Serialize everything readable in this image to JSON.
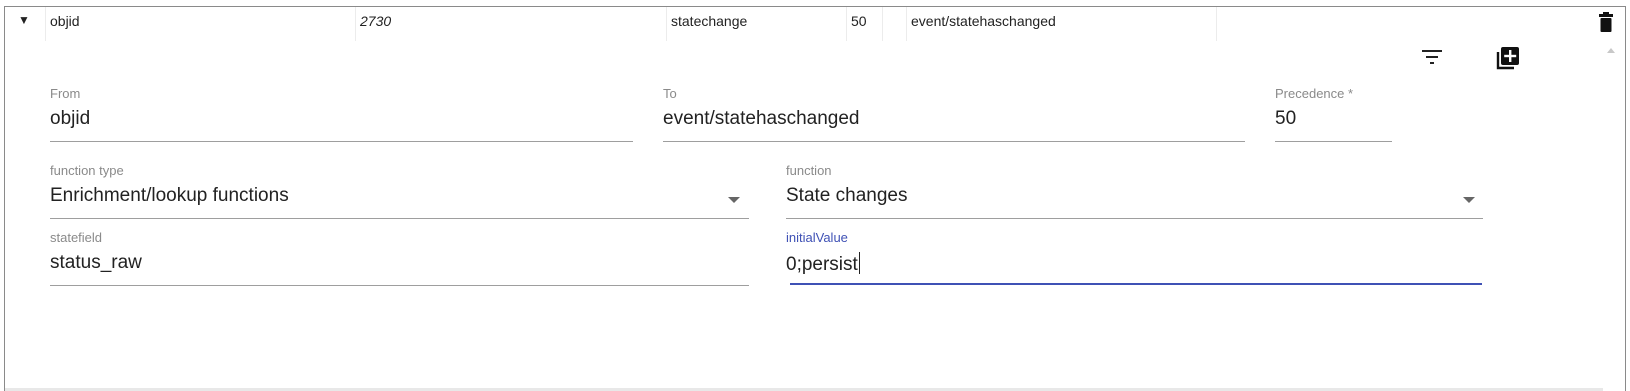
{
  "summary_row": {
    "toggle_glyph": "▼",
    "from": "objid",
    "id": "2730",
    "function": "statechange",
    "precedence": "50",
    "to": "event/statehaschanged"
  },
  "toolbar": {
    "filter_icon": "filter-icon",
    "add_icon": "add-box-icon",
    "delete_icon": "trash-icon"
  },
  "form": {
    "from": {
      "label": "From",
      "value": "objid"
    },
    "to": {
      "label": "To",
      "value": "event/statehaschanged"
    },
    "precedence": {
      "label": "Precedence *",
      "value": "50"
    },
    "function_type": {
      "label": "function type",
      "value": "Enrichment/lookup functions"
    },
    "function": {
      "label": "function",
      "value": "State changes"
    },
    "statefield": {
      "label": "statefield",
      "value": "status_raw"
    },
    "initial_value": {
      "label": "initialValue",
      "value": "0;persist"
    }
  },
  "colors": {
    "accent": "#3f51b5",
    "label": "#8a8a8a",
    "underline": "#9e9e9e"
  }
}
